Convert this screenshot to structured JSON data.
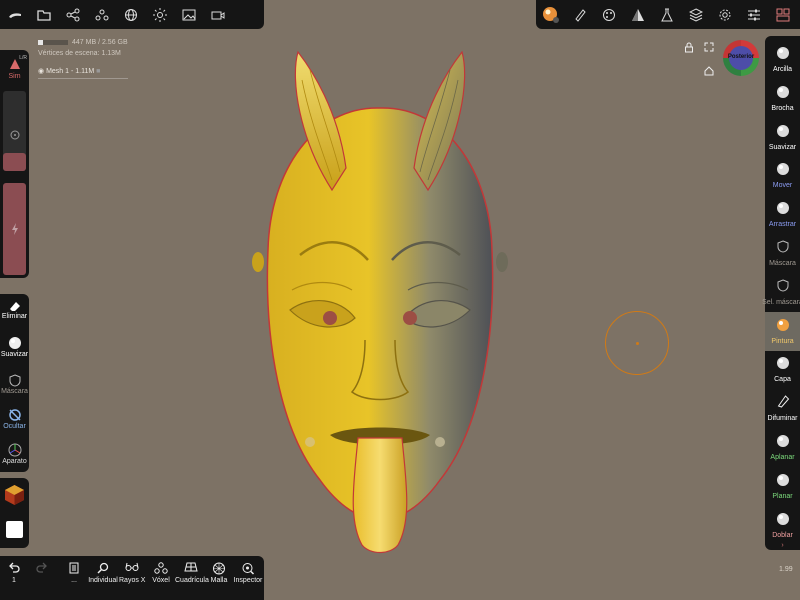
{
  "top_toolbar_left": {
    "icons": [
      "menu-icon",
      "folder-icon",
      "share-icon",
      "scene-icon",
      "sphere-icon",
      "sun-icon",
      "image-icon",
      "camera-icon"
    ]
  },
  "top_toolbar_right": {
    "icons": [
      "material-icon",
      "brush-icon",
      "palette-icon",
      "gradient-icon",
      "flask-icon",
      "layers-icon",
      "settings-icon",
      "sliders-icon",
      "tools-icon"
    ]
  },
  "scene_info": {
    "memory": "447 MB / 2.56 GB",
    "memory_fraction": 0.17,
    "vertices_label": "Vértices de escena:",
    "vertices_value": "1.13M",
    "mesh_name": "Mesh 1",
    "mesh_vertices": "1.11M"
  },
  "symmetry": {
    "label": "Sim",
    "axis": "L/R"
  },
  "left_tools": [
    {
      "label": "Eliminar",
      "icon": "eraser-icon",
      "color": "#ffffff"
    },
    {
      "label": "Suavizar",
      "icon": "smooth-icon",
      "color": "#ffffff"
    },
    {
      "label": "Máscara",
      "icon": "mask-icon",
      "color": "#a09a92"
    },
    {
      "label": "Ocultar",
      "icon": "hide-icon",
      "color": "#8ab4e8"
    },
    {
      "label": "Aparato",
      "icon": "gizmo-icon",
      "color": "#d8d8d8"
    }
  ],
  "bottom_tools": [
    {
      "label": "1",
      "icon": "undo-icon"
    },
    {
      "label": "",
      "icon": "redo-icon"
    },
    {
      "label": "...",
      "icon": "document-icon"
    },
    {
      "label": "Individual",
      "icon": "search-icon"
    },
    {
      "label": "Rayos X",
      "icon": "glasses-icon"
    },
    {
      "label": "Vóxel",
      "icon": "voxel-icon"
    },
    {
      "label": "Cuadrícula",
      "icon": "grid-icon"
    },
    {
      "label": "Malla",
      "icon": "mesh-icon"
    },
    {
      "label": "Inspector",
      "icon": "inspector-icon"
    }
  ],
  "right_tools": [
    {
      "label": "Arcilla",
      "color": "#ffffff"
    },
    {
      "label": "Brocha",
      "color": "#ffffff"
    },
    {
      "label": "Suavizar",
      "color": "#ffffff"
    },
    {
      "label": "Mover",
      "color": "#8b9cf2"
    },
    {
      "label": "Arrastrar",
      "color": "#8b9cf2"
    },
    {
      "label": "Máscara",
      "color": "#a09a92"
    },
    {
      "label": "Sel. máscara",
      "color": "#a09a92"
    },
    {
      "label": "Pintura",
      "color": "#f1c86a"
    },
    {
      "label": "Capa",
      "color": "#ffffff"
    },
    {
      "label": "Difuminar",
      "color": "#ffffff"
    },
    {
      "label": "Aplanar",
      "color": "#7ddc7d"
    },
    {
      "label": "Planar",
      "color": "#7ddc7d"
    },
    {
      "label": "Doblar",
      "color": "#f0a0a0"
    }
  ],
  "active_tool": "Pintura",
  "view_cube": {
    "label": "Posterior"
  },
  "version": "1.99",
  "colors": {
    "background": "#7d7265",
    "panel": "#151515",
    "accent_red": "#8b4d52",
    "mask_gold": "#e2b81c",
    "cursor": "#d07a16"
  }
}
